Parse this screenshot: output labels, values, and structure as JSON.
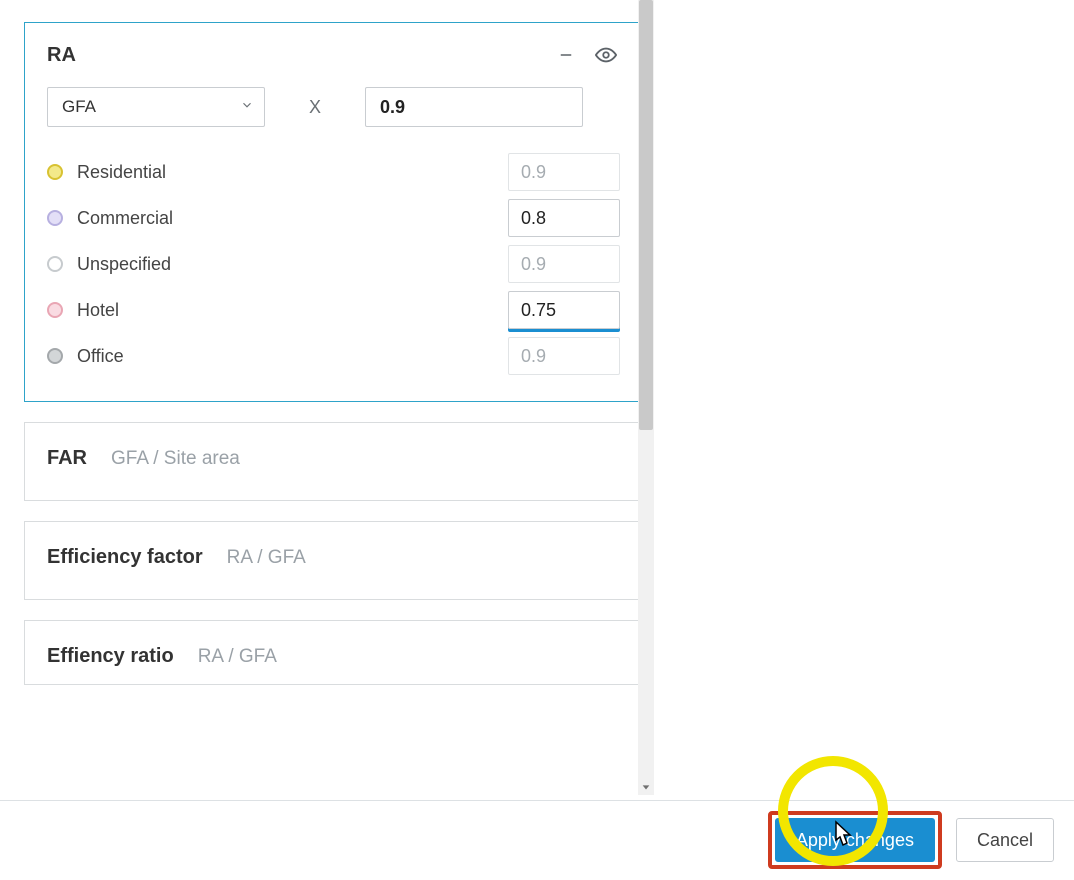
{
  "ra_card": {
    "title": "RA",
    "select_label": "GFA",
    "multiplier_symbol": "X",
    "default_value": "0.9",
    "uses": [
      {
        "label": "Residential",
        "value": "0.9",
        "state": "placeholder",
        "dot": "yellow"
      },
      {
        "label": "Commercial",
        "value": "0.8",
        "state": "active",
        "dot": "purple"
      },
      {
        "label": "Unspecified",
        "value": "0.9",
        "state": "placeholder",
        "dot": "empty"
      },
      {
        "label": "Hotel",
        "value": "0.75",
        "state": "focus",
        "dot": "pink"
      },
      {
        "label": "Office",
        "value": "0.9",
        "state": "placeholder",
        "dot": "gray"
      }
    ]
  },
  "metric_cards": [
    {
      "title": "FAR",
      "formula": "GFA / Site area"
    },
    {
      "title": "Efficiency factor",
      "formula": "RA / GFA"
    },
    {
      "title": "Effiency ratio",
      "formula": "RA / GFA"
    }
  ],
  "footer": {
    "apply_label": "Apply changes",
    "cancel_label": "Cancel"
  }
}
